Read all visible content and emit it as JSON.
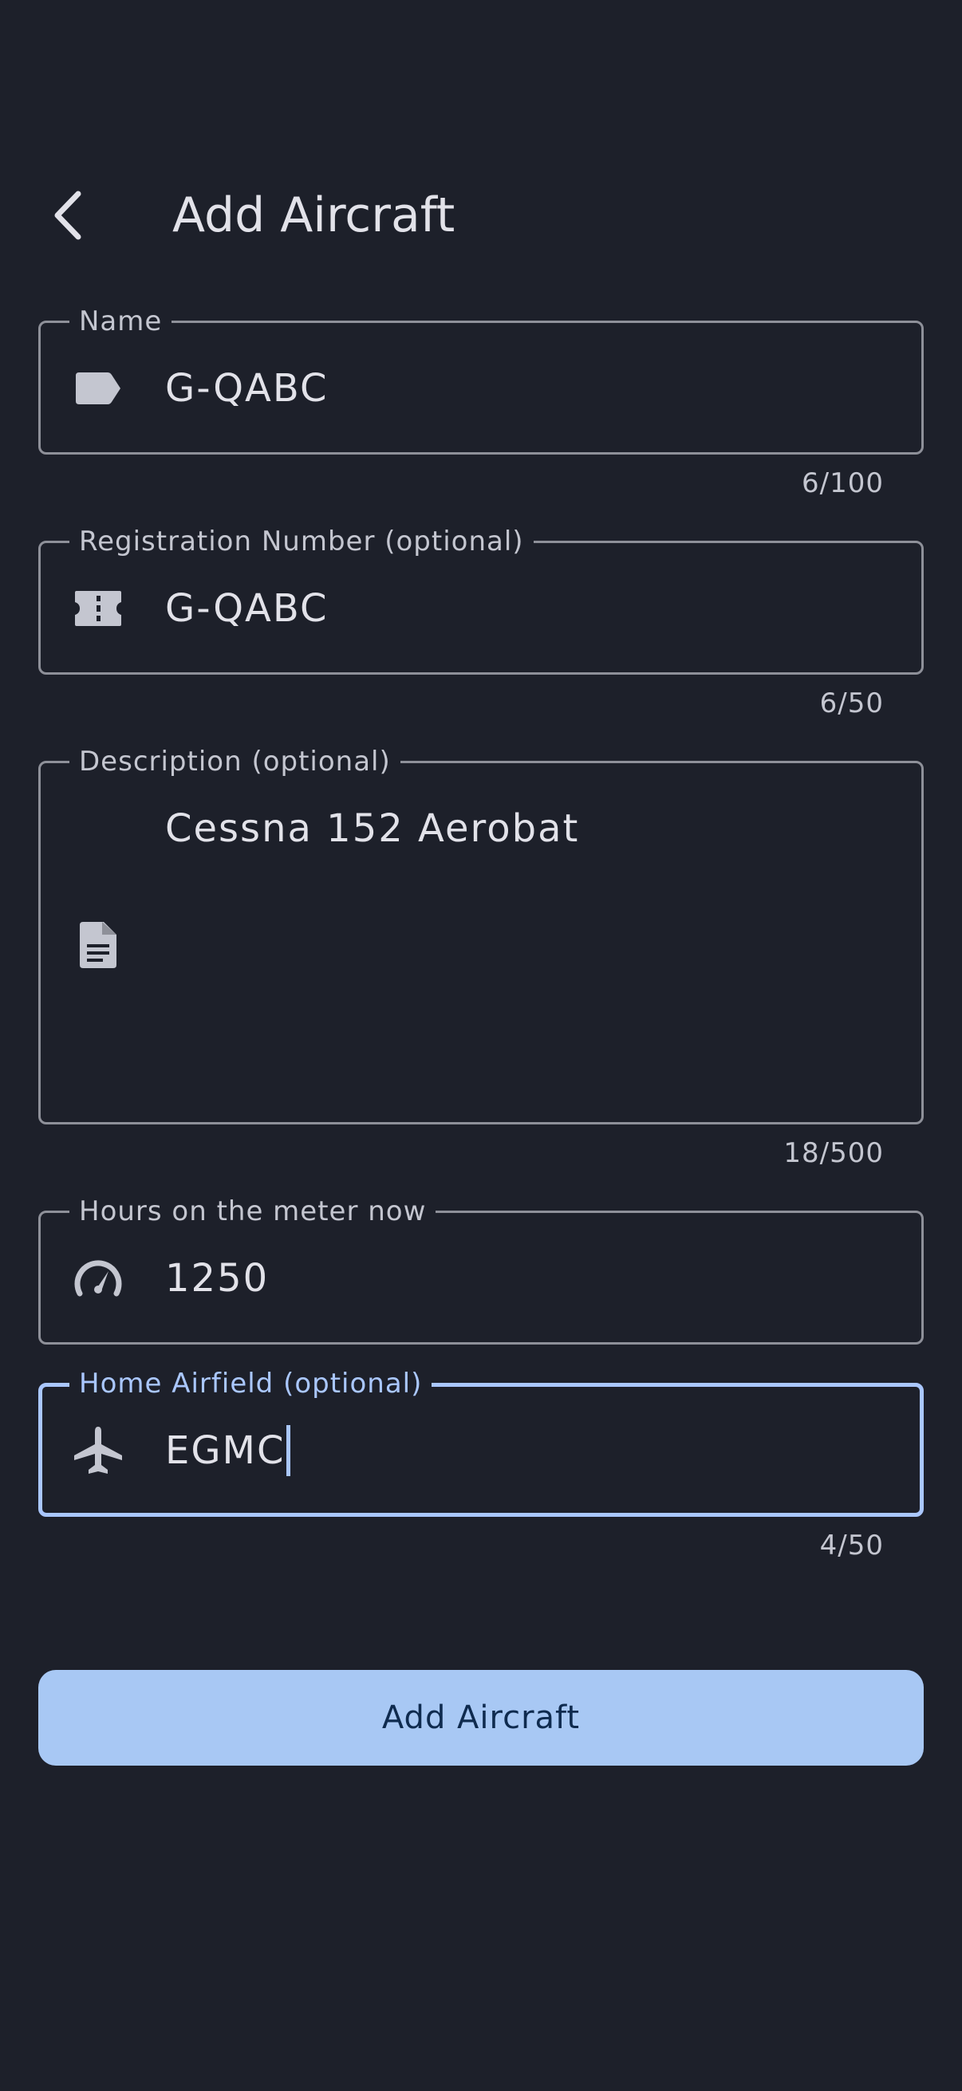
{
  "header": {
    "title": "Add Aircraft"
  },
  "fields": {
    "name": {
      "label": "Name",
      "value": "G-QABC",
      "counter": "6/100",
      "icon": "label-tag-icon"
    },
    "registration": {
      "label": "Registration Number (optional)",
      "value": "G-QABC",
      "counter": "6/50",
      "icon": "ticket-icon"
    },
    "description": {
      "label": "Description (optional)",
      "value": "Cessna 152 Aerobat",
      "counter": "18/500",
      "icon": "document-icon"
    },
    "hours": {
      "label": "Hours on the meter now",
      "value": "1250",
      "icon": "speedometer-icon"
    },
    "home_airfield": {
      "label": "Home Airfield (optional)",
      "value": "EGMC",
      "counter": "4/50",
      "icon": "airplane-icon"
    }
  },
  "submit": {
    "label": "Add Aircraft"
  },
  "colors": {
    "background": "#1d202a",
    "outline": "#8e9099",
    "focus_accent": "#aac7ff",
    "button_bg": "#a8c8f4",
    "button_text": "#0f2b4f",
    "text": "#e2e2e9",
    "secondary_text": "#c4c6d0"
  }
}
